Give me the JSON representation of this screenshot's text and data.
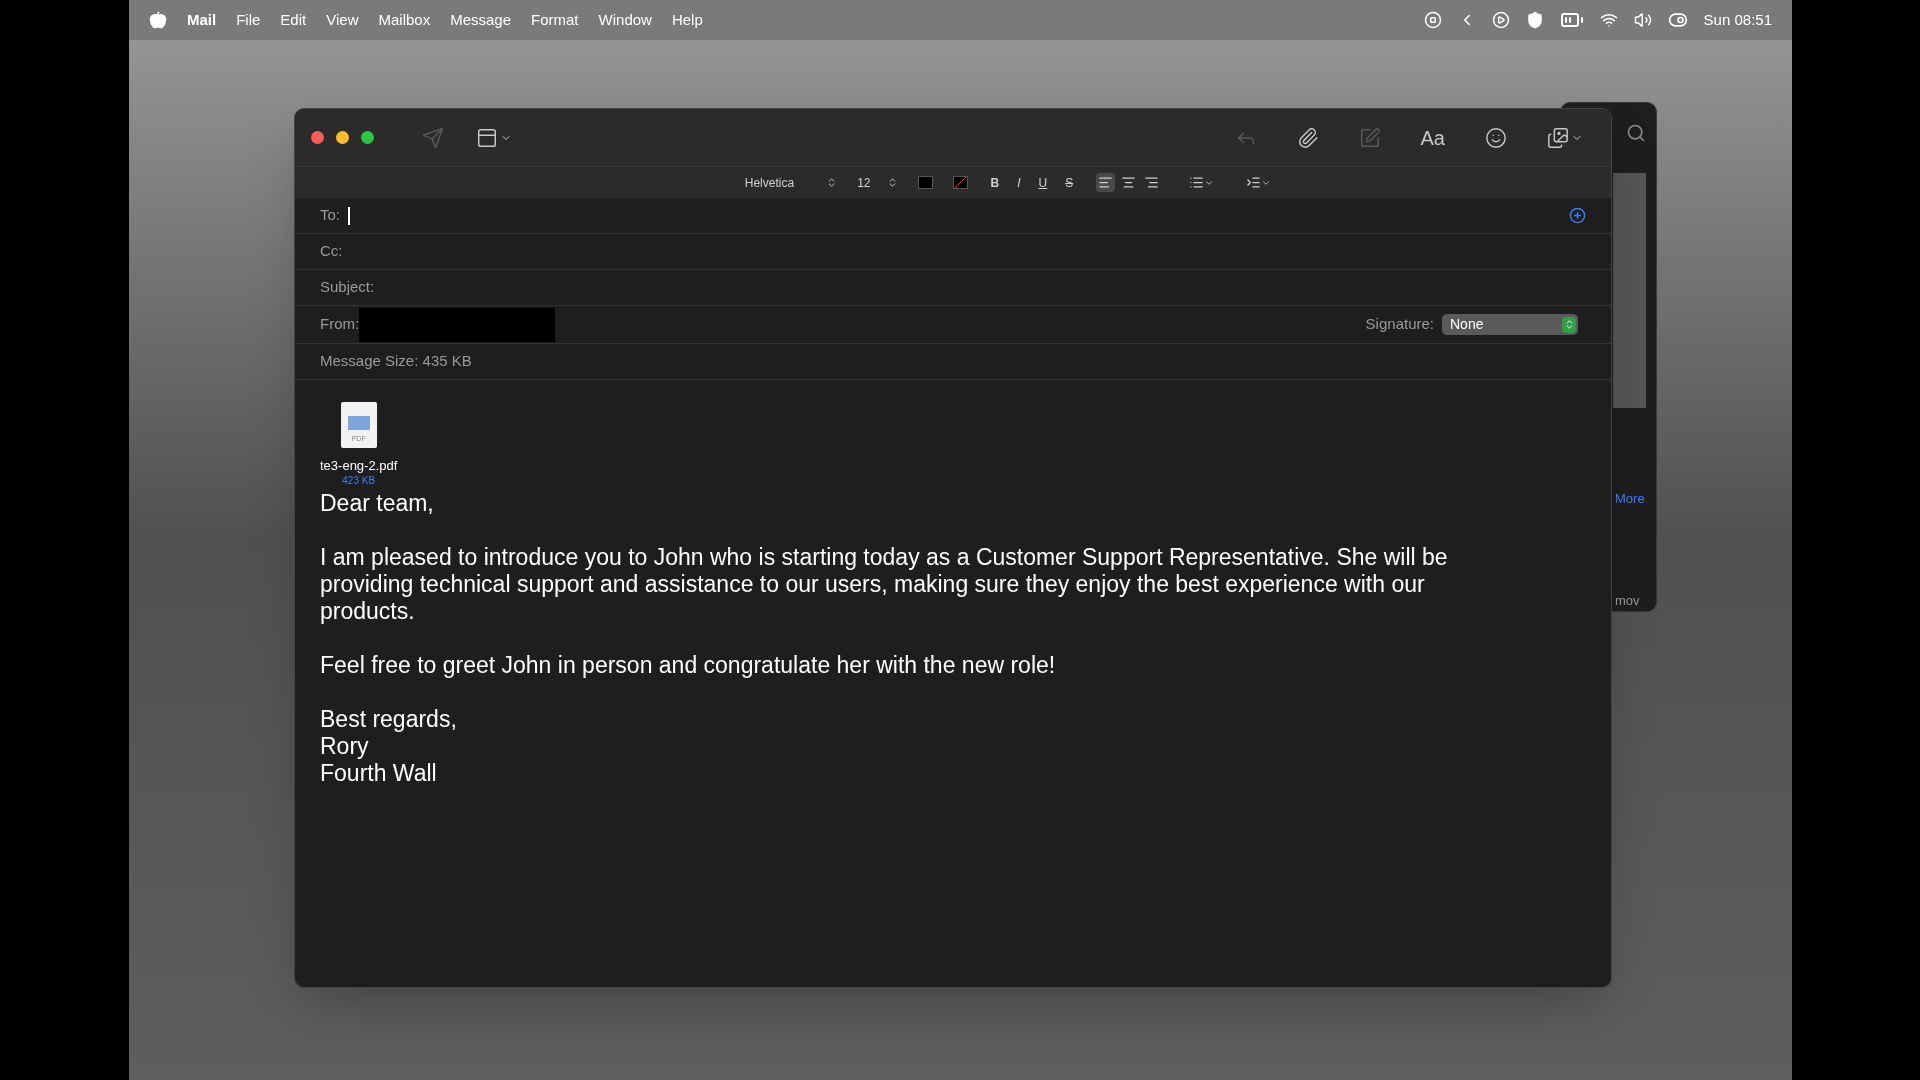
{
  "menu_bar": {
    "app_name": "Mail",
    "menus": [
      "File",
      "Edit",
      "View",
      "Mailbox",
      "Message",
      "Format",
      "Window",
      "Help"
    ],
    "clock": "Sun 08:51"
  },
  "toolbar": {
    "left": [
      {
        "kind": "send",
        "disabled": true
      },
      {
        "kind": "header",
        "disabled": false
      }
    ],
    "right": [
      {
        "kind": "reply",
        "disabled": true
      },
      {
        "kind": "attach",
        "disabled": false
      },
      {
        "kind": "markup",
        "disabled": true
      },
      {
        "kind": "fonts",
        "label": "Aa",
        "disabled": false
      },
      {
        "kind": "emoji",
        "disabled": false
      },
      {
        "kind": "photos",
        "disabled": false
      }
    ]
  },
  "format_bar": {
    "font": "Helvetica",
    "size": "12",
    "styles": [
      {
        "kind": "bold",
        "label": "B"
      },
      {
        "kind": "italic",
        "label": "I"
      },
      {
        "kind": "underline",
        "label": "U"
      },
      {
        "kind": "strike",
        "label": "S"
      }
    ],
    "alignments": [
      {
        "kind": "left",
        "selected": true
      },
      {
        "kind": "center",
        "selected": false
      },
      {
        "kind": "right",
        "selected": false
      }
    ]
  },
  "fields": [
    {
      "label": "To:",
      "focused": true
    },
    {
      "label": "Cc:",
      "focused": false
    },
    {
      "label": "Subject:",
      "focused": false
    }
  ],
  "from": {
    "label": "From:",
    "redacted": true
  },
  "signature": {
    "label": "Signature:",
    "value": "None"
  },
  "message_size": "Message Size: 435 KB",
  "attachment": {
    "name": "te3-eng-2.pdf",
    "size": "423 KB",
    "icon_label": "PDF"
  },
  "body": [
    [
      "Dear team,"
    ],
    [
      "I am pleased to introduce you to John who is starting today as a Customer Support Representative. She will be providing technical support and assistance to our users, making sure they enjoy the best experience with our products."
    ],
    [
      "Feel free to greet John in person and congratulate her with the new role!"
    ],
    [
      "Best regards,",
      "Rory",
      "Fourth Wall"
    ]
  ],
  "background_window": {
    "link": "More",
    "file_label": "mov"
  }
}
